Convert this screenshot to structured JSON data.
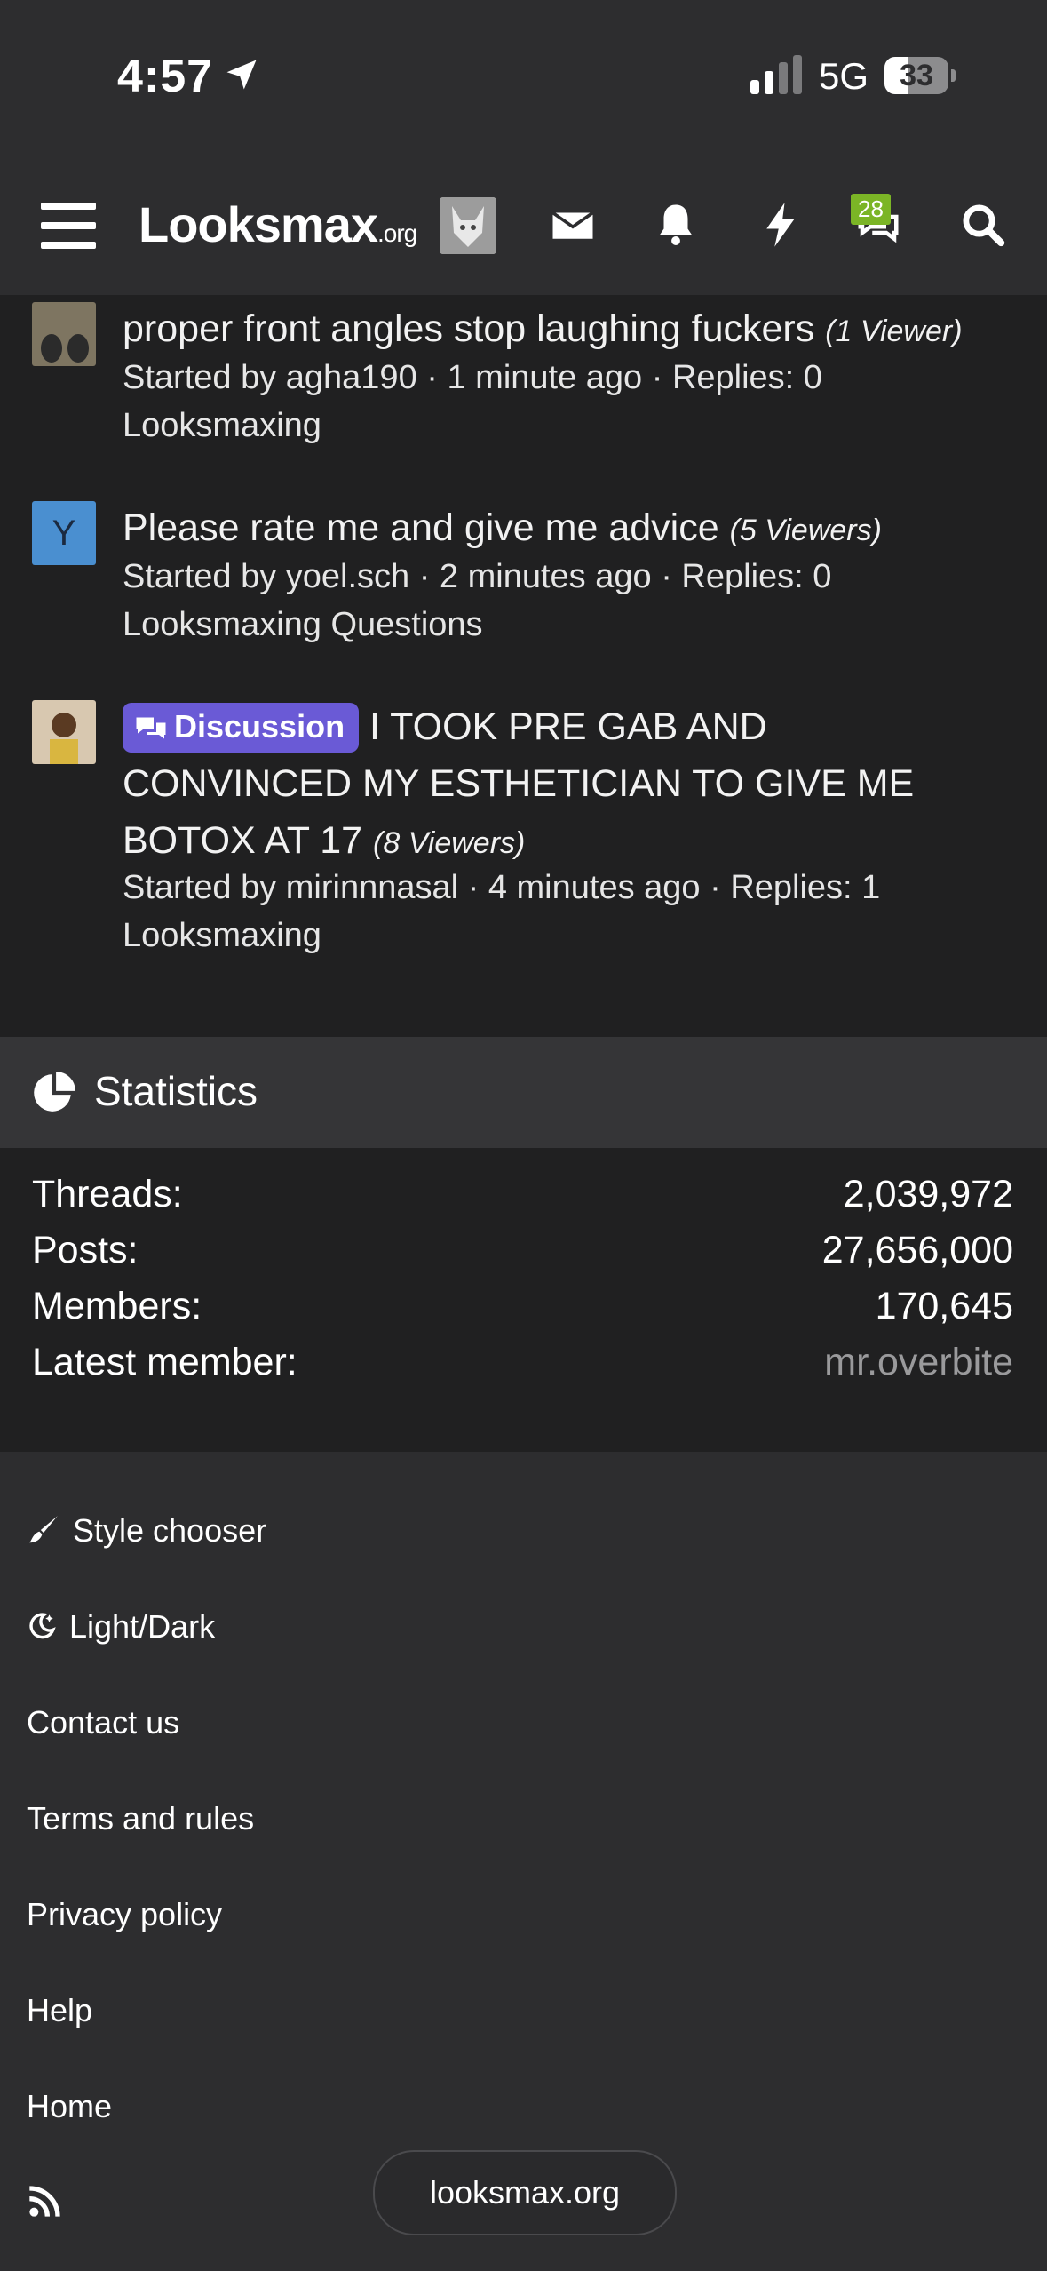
{
  "status_bar": {
    "time": "4:57",
    "network": "5G",
    "battery": "33"
  },
  "navbar": {
    "logo_main": "Looksmax",
    "logo_suffix": ".org",
    "conversations_badge": "28"
  },
  "threads": [
    {
      "title": "proper front angles stop laughing fuckers",
      "viewers": "(1 Viewer)",
      "meta": "Started by agha190 · 1 minute ago · Replies: 0",
      "forum": "Looksmaxing"
    },
    {
      "avatar_letter": "Y",
      "title": "Please rate me and give me advice",
      "viewers": "(5 Viewers)",
      "meta": "Started by yoel.sch · 2 minutes ago · Replies: 0",
      "forum": "Looksmaxing Questions"
    },
    {
      "prefix": "Discussion",
      "title_line1": "I TOOK PRE GAB AND",
      "title_line2": "CONVINCED MY ESTHETICIAN TO GIVE ME",
      "title_line3": "BOTOX AT 17",
      "viewers": "(8 Viewers)",
      "meta": "Started by mirinnnasal · 4 minutes ago · Replies: 1",
      "forum": "Looksmaxing"
    }
  ],
  "statistics": {
    "heading": "Statistics",
    "rows": [
      {
        "label": "Threads:",
        "value": "2,039,972"
      },
      {
        "label": "Posts:",
        "value": "27,656,000"
      },
      {
        "label": "Members:",
        "value": "170,645"
      },
      {
        "label": "Latest member:",
        "value": "mr.overbite"
      }
    ]
  },
  "footer": {
    "links": [
      "Style chooser",
      "Light/Dark",
      "Contact us",
      "Terms and rules",
      "Privacy policy",
      "Help",
      "Home"
    ]
  },
  "browser": {
    "url": "looksmax.org"
  },
  "colors": {
    "prefix": "#6a5ad6",
    "badge": "#7bb526",
    "avatar_y": "#4a8fd0"
  }
}
